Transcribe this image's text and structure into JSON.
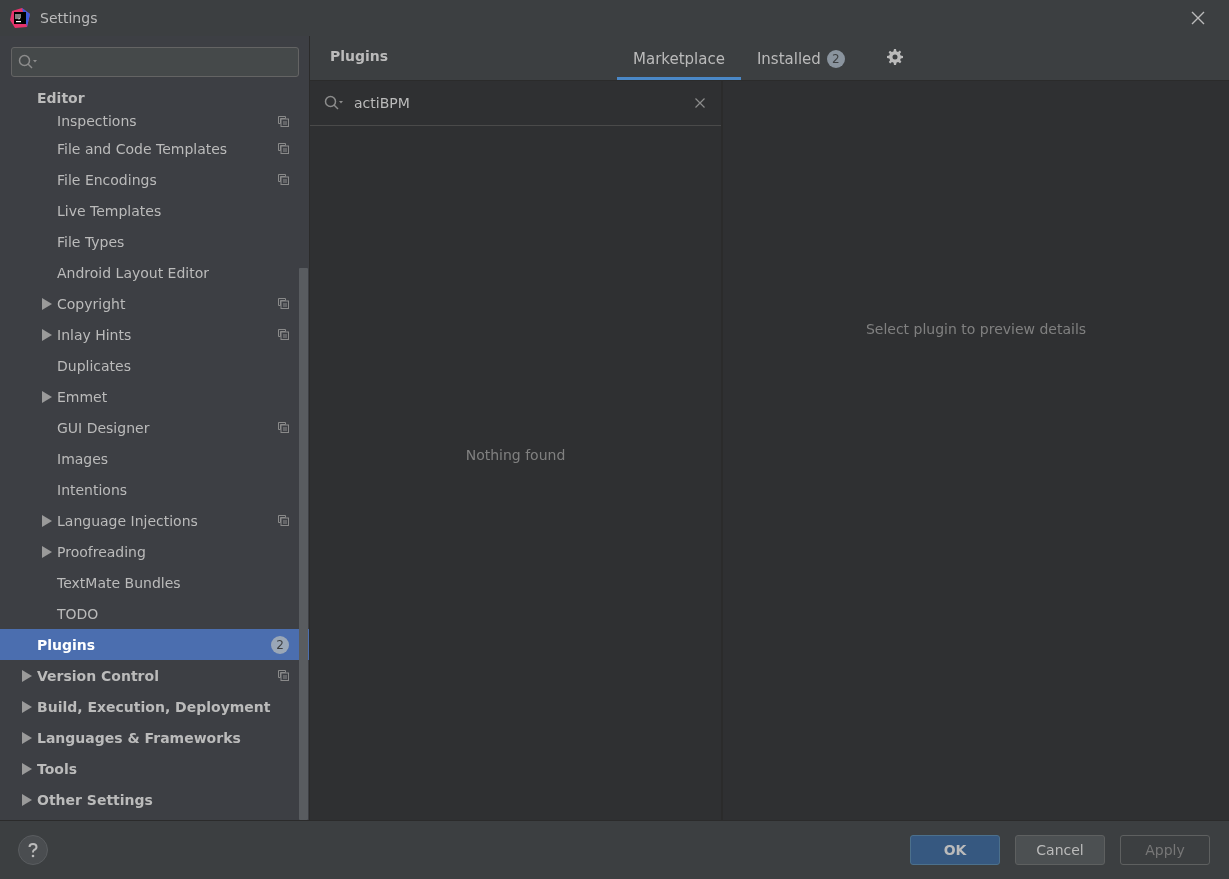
{
  "window": {
    "title": "Settings"
  },
  "sidebar": {
    "items": [
      {
        "label": "Editor",
        "kind": "section",
        "children": [
          {
            "label": "Inspections",
            "kind": "page",
            "selected": false,
            "project_level": true
          },
          {
            "label": "File and Code Templates",
            "kind": "page",
            "selected": false,
            "project_level": true
          },
          {
            "label": "File Encodings",
            "kind": "page",
            "selected": false,
            "project_level": true
          },
          {
            "label": "Live Templates",
            "kind": "page",
            "selected": false,
            "project_level": false
          },
          {
            "label": "File Types",
            "kind": "page",
            "selected": false,
            "project_level": false
          },
          {
            "label": "Android Layout Editor",
            "kind": "page",
            "selected": false,
            "project_level": false
          },
          {
            "label": "Copyright",
            "kind": "folder",
            "expanded": false,
            "selected": false,
            "project_level": true
          },
          {
            "label": "Inlay Hints",
            "kind": "folder",
            "expanded": false,
            "selected": false,
            "project_level": true
          },
          {
            "label": "Duplicates",
            "kind": "page",
            "selected": false,
            "project_level": false
          },
          {
            "label": "Emmet",
            "kind": "folder",
            "expanded": false,
            "selected": false,
            "project_level": false
          },
          {
            "label": "GUI Designer",
            "kind": "page",
            "selected": false,
            "project_level": true
          },
          {
            "label": "Images",
            "kind": "page",
            "selected": false,
            "project_level": false
          },
          {
            "label": "Intentions",
            "kind": "page",
            "selected": false,
            "project_level": false
          },
          {
            "label": "Language Injections",
            "kind": "folder",
            "expanded": false,
            "selected": false,
            "project_level": true
          },
          {
            "label": "Proofreading",
            "kind": "folder",
            "expanded": false,
            "selected": false,
            "project_level": false
          },
          {
            "label": "TextMate Bundles",
            "kind": "page",
            "selected": false,
            "project_level": false
          },
          {
            "label": "TODO",
            "kind": "page",
            "selected": false,
            "project_level": false
          }
        ]
      },
      {
        "label": "Plugins",
        "kind": "page",
        "selected": true,
        "project_level": false,
        "badge": "2"
      },
      {
        "label": "Version Control",
        "kind": "folder",
        "expanded": false,
        "selected": false,
        "project_level": true
      },
      {
        "label": "Build, Execution, Deployment",
        "kind": "folder",
        "expanded": false,
        "selected": false,
        "project_level": false
      },
      {
        "label": "Languages & Frameworks",
        "kind": "folder",
        "expanded": false,
        "selected": false,
        "project_level": false
      },
      {
        "label": "Tools",
        "kind": "folder",
        "expanded": false,
        "selected": false,
        "project_level": false
      },
      {
        "label": "Other Settings",
        "kind": "folder",
        "expanded": false,
        "selected": false,
        "project_level": false
      }
    ]
  },
  "content": {
    "title": "Plugins",
    "tabs": [
      {
        "label": "Marketplace",
        "selected": true
      },
      {
        "label": "Installed",
        "selected": false,
        "badge": "2"
      }
    ],
    "search": {
      "value": "actiBPM"
    },
    "results_message": "Nothing found",
    "details_message": "Select plugin to preview details"
  },
  "buttons": [
    {
      "label": "OK",
      "kind": "primary",
      "disabled": false
    },
    {
      "label": "Cancel",
      "kind": "normal",
      "disabled": false
    },
    {
      "label": "Apply",
      "kind": "normal",
      "disabled": true
    }
  ]
}
